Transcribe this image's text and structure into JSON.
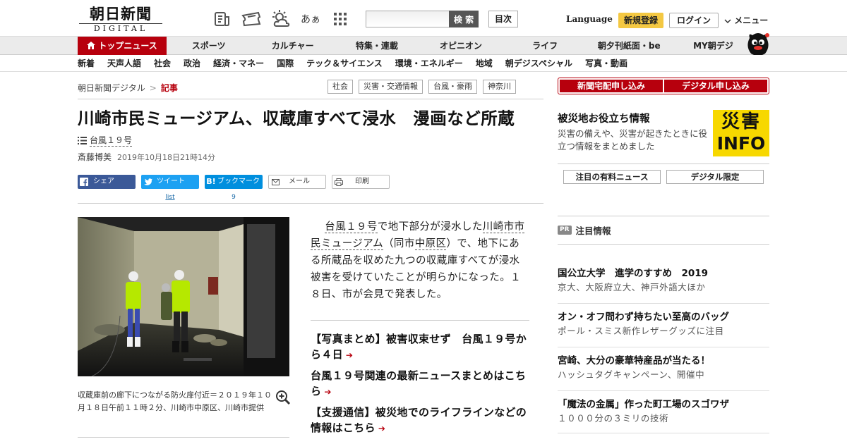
{
  "header": {
    "logo_main": "朝日新聞",
    "logo_sub": "DIGITAL",
    "search_button": "検 索",
    "search_placeholder": "",
    "mokuji": "目次",
    "language": "Language",
    "register": "新規登録",
    "login": "ログイン",
    "menu": "メニュー",
    "icons": [
      "newspaper-icon",
      "ticket-icon",
      "weather-icon",
      "font-size-icon",
      "grid-icon"
    ],
    "font_icon_text": "あぁ"
  },
  "nav_main": [
    "トップニュース",
    "スポーツ",
    "カルチャー",
    "特集・連載",
    "オピニオン",
    "ライフ",
    "朝夕刊紙面・be",
    "MY朝デジ"
  ],
  "nav_sub": [
    "新着",
    "天声人語",
    "社会",
    "政治",
    "経済・マネー",
    "国際",
    "テック＆サイエンス",
    "環境・エネルギー",
    "地域",
    "朝デジスペシャル",
    "写真・動画"
  ],
  "breadcrumb": {
    "home": "朝日新聞デジタル",
    "sep": ">",
    "current": "記事"
  },
  "tags": [
    "社会",
    "災害・交通情報",
    "台風・豪雨",
    "神奈川"
  ],
  "article": {
    "headline": "川崎市民ミュージアム、収蔵庫すべて浸水　漫画など所蔵",
    "topic": "台風１９号",
    "author": "斎藤博美",
    "date": "2019年10月18日21時14分",
    "share": {
      "facebook": "シェア",
      "twitter": "ツイート",
      "twitter_count": "list",
      "hatena": "ブックマーク",
      "hatena_count": "9",
      "mail": "メール",
      "print": "印刷"
    },
    "caption": "収蔵庫前の廊下につながる防火扉付近＝２０１９年１０月１８日午前１１時２分、川崎市中原区、川崎市提供",
    "body": {
      "link1": "台風１９号",
      "t1": "で地下部分が浸水した",
      "link2": "川崎市市民ミュージアム",
      "t2": "（同市",
      "link3": "中原区",
      "t3": "）で、地下にある所蔵品を収めた九つの収蔵庫すべてが浸水被害を受けていたことが明らかになった。１８日、市が会見で発表した。"
    },
    "related": [
      "【写真まとめ】被害収束せず　台風１９号から４日",
      "台風１９号関連の最新ニュースまとめはこちら",
      "【支援通信】被災地でのライフラインなどの情報はこちら"
    ]
  },
  "sidebar": {
    "subscribe": [
      "新聞宅配申し込み",
      "デジタル申し込み"
    ],
    "disaster_title": "被災地お役立ち情報",
    "disaster_desc": "災害の備えや、災害が起きたときに役立つ情報をまとめました",
    "disaster_logo_top": "災害",
    "disaster_logo_bottom": "INFO",
    "paid_buttons": [
      "注目の有料ニュース",
      "デジタル限定"
    ],
    "pr_badge": "PR",
    "pr_heading": "注目情報",
    "ads": [
      {
        "title": "国公立大学　進学のすすめ　2019",
        "sub": "京大、大阪府立大、神戸外語大ほか"
      },
      {
        "title": "オン・オフ問わず持ちたい至高のバッグ",
        "sub": "ポール・スミス新作レザーグッズに注目"
      },
      {
        "title": "宮崎、大分の豪華特産品が当たる！",
        "sub": "ハッシュタグキャンペーン、開催中"
      },
      {
        "title": "「魔法の金属」作った町工場のスゴワザ",
        "sub": "１０００分の３ミリの技術"
      }
    ]
  },
  "colors": {
    "brand_red": "#b7000d",
    "register_yellow": "#f4c842",
    "info_yellow": "#f7d800"
  }
}
